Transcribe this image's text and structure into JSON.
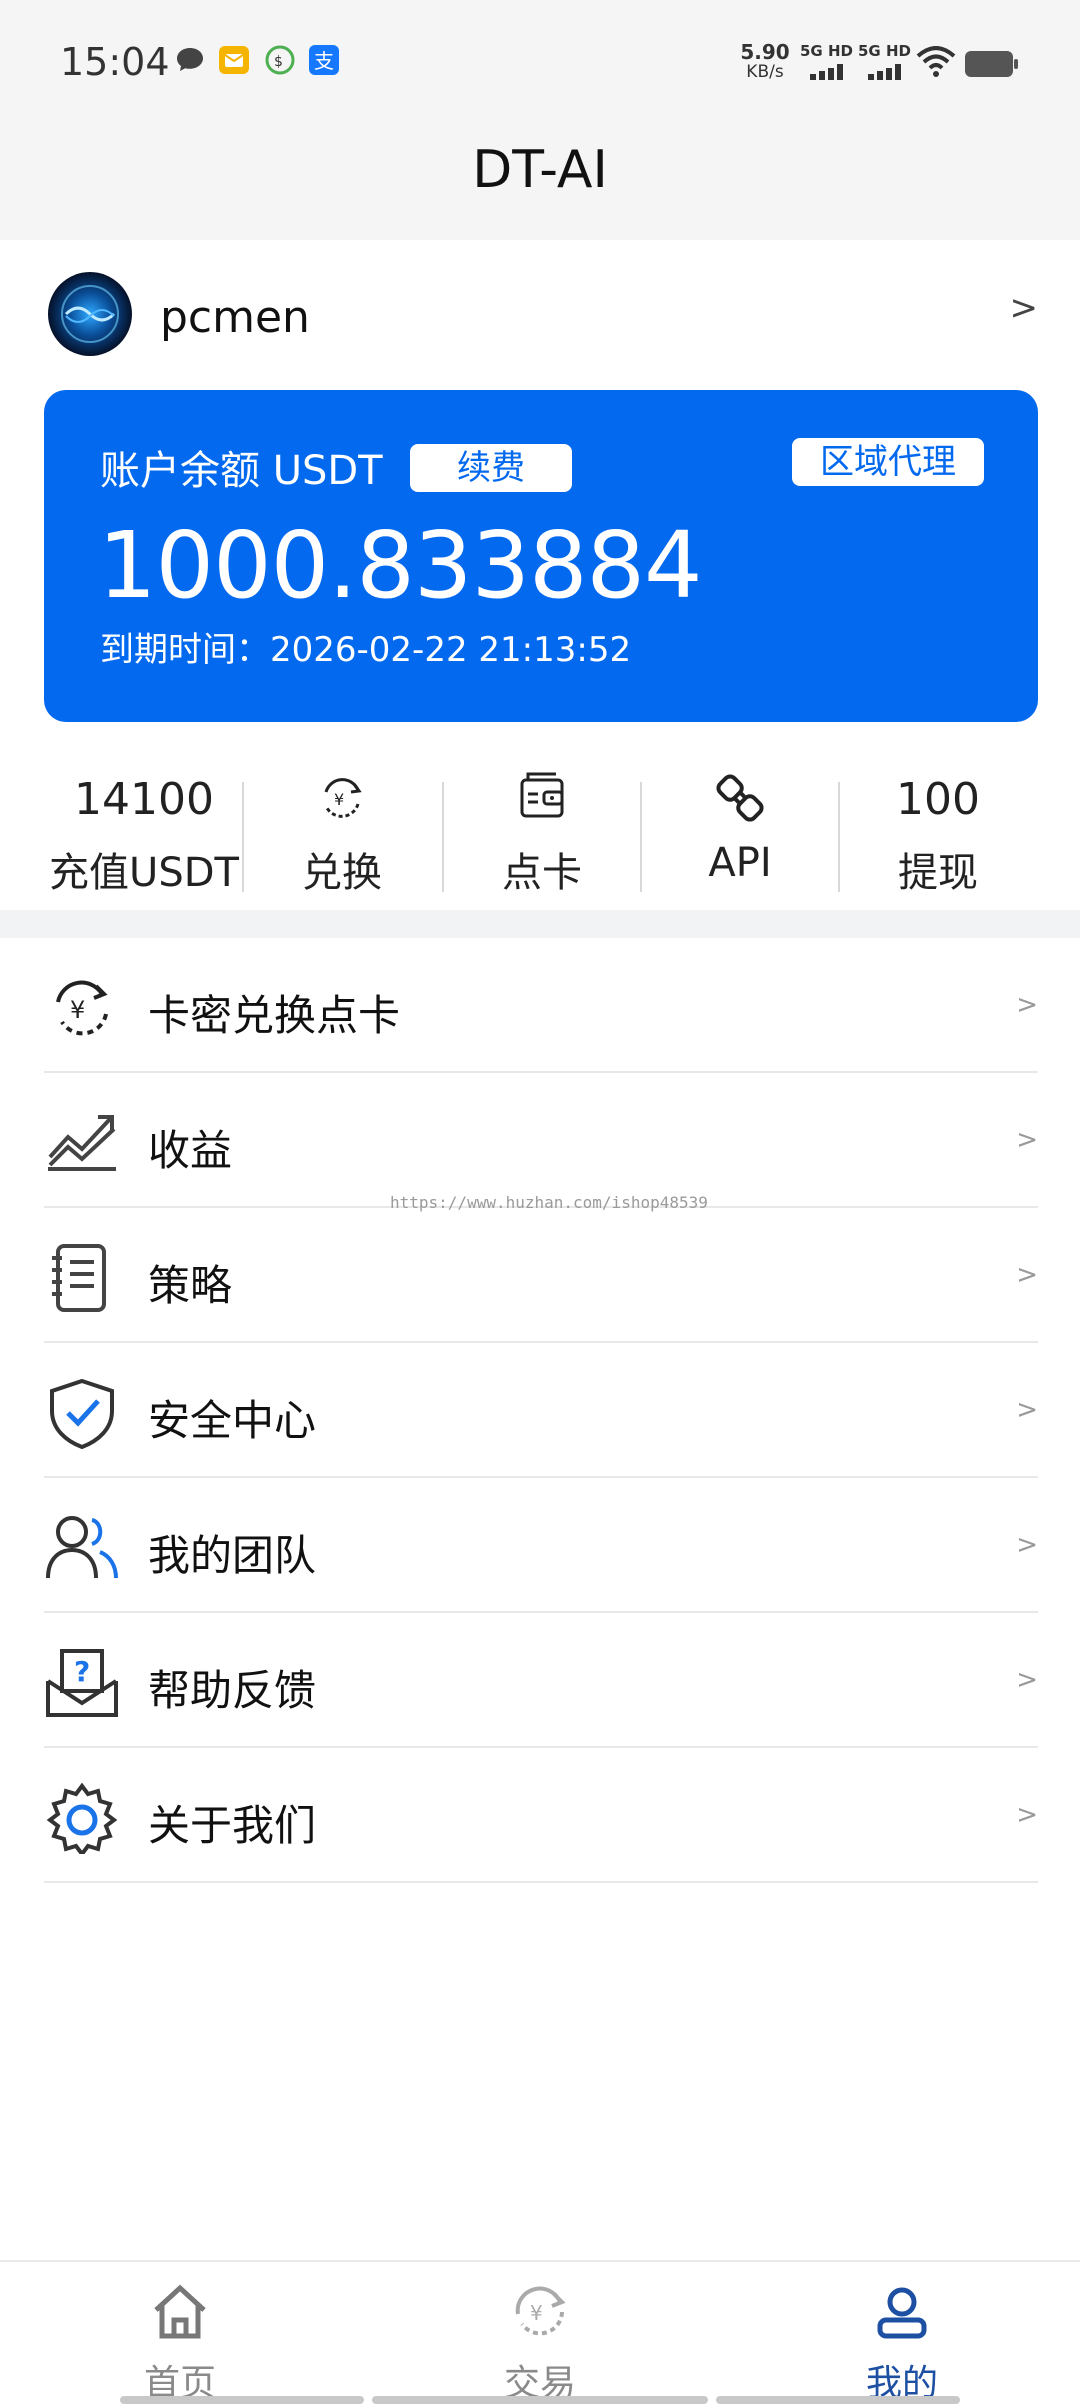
{
  "status_bar": {
    "time": "15:04",
    "net_speed_value": "5.90",
    "net_speed_unit": "KB/s",
    "signal1_label": "5G HD",
    "signal2_label": "5G HD"
  },
  "header": {
    "title": "DT-AI"
  },
  "profile": {
    "username": "pcmen",
    "arrow": ">"
  },
  "balance_card": {
    "label": "账户余额 USDT",
    "renew_button": "续费",
    "agent_button": "区域代理",
    "balance": "1000.833884",
    "expiry": "到期时间：2026-02-22 21:13:52",
    "color": "#0369ef"
  },
  "stats": [
    {
      "value": "14100",
      "label": "充值USDT"
    },
    {
      "icon": "exchange-icon",
      "label": "兑换"
    },
    {
      "icon": "wallet-card-icon",
      "label": "点卡"
    },
    {
      "icon": "plug-icon",
      "label": "API"
    },
    {
      "value": "100",
      "label": "提现"
    }
  ],
  "menu": [
    {
      "icon": "yuan-exchange-icon",
      "label": "卡密兑换点卡",
      "arrow": ">"
    },
    {
      "icon": "chart-trend-icon",
      "label": "收益",
      "arrow": ">"
    },
    {
      "icon": "notebook-icon",
      "label": "策略",
      "arrow": ">"
    },
    {
      "icon": "shield-check-icon",
      "label": "安全中心",
      "arrow": ">"
    },
    {
      "icon": "team-icon",
      "label": "我的团队",
      "arrow": ">"
    },
    {
      "icon": "help-box-icon",
      "label": "帮助反馈",
      "arrow": ">"
    },
    {
      "icon": "gear-icon",
      "label": "关于我们",
      "arrow": ">"
    }
  ],
  "watermark": "https://www.huzhan.com/ishop48539",
  "bottom_nav": [
    {
      "icon": "home-icon",
      "label": "首页",
      "active": false
    },
    {
      "icon": "trade-icon",
      "label": "交易",
      "active": false
    },
    {
      "icon": "user-icon",
      "label": "我的",
      "active": true
    }
  ]
}
